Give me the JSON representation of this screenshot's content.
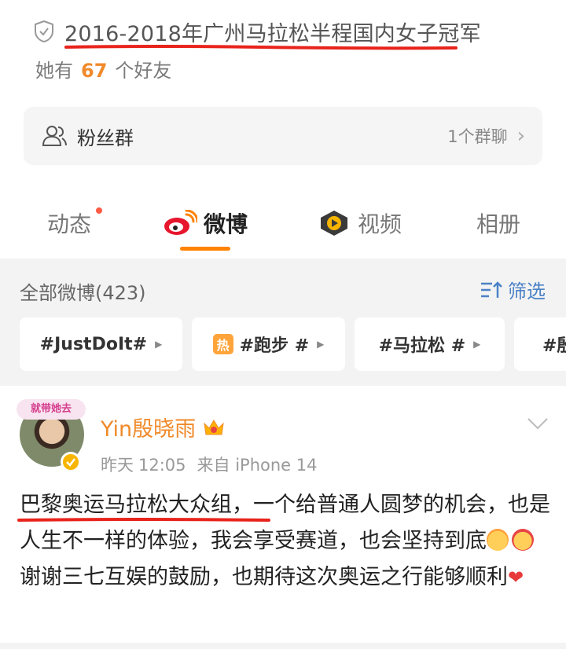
{
  "profile": {
    "honor": "2016-2018年广州马拉松半程国内女子冠军",
    "friends_prefix": "她有",
    "friends_count": "67",
    "friends_suffix": "个好友"
  },
  "fan_group": {
    "label": "粉丝群",
    "count": "1个群聊",
    "chevron": "›"
  },
  "tabs": [
    {
      "label": "动态",
      "has_dot": true
    },
    {
      "label": "微博",
      "active": true
    },
    {
      "label": "视频"
    },
    {
      "label": "相册"
    }
  ],
  "posts_header": {
    "all_label": "全部微博(423)",
    "filter_label": "筛选"
  },
  "topic_chips": [
    {
      "label": "#JustDoIt#"
    },
    {
      "label": "#跑步 #",
      "badge": "热"
    },
    {
      "label": "#马拉松 #"
    },
    {
      "label": "#殷"
    }
  ],
  "post": {
    "avatar_tag": "就带她去",
    "username": "Yin殷晓雨",
    "time_label": "昨天",
    "time": "12:05",
    "source": "来自 iPhone 14",
    "text_part1": "巴黎奥运马拉松大众组，一个给普通人圆梦的机会，也是人生不一样的体验，我会享受赛道，也会坚持到底",
    "text_part2": " 谢谢三七互娱的鼓励，也期待这次奥运之行能够顺利",
    "heart": "❤"
  },
  "colors": {
    "accent": "#ff8200",
    "username": "#f08a2a",
    "link_blue": "#4b82c7",
    "annotation_red": "#e8231b"
  },
  "icons": [
    "shield-icon",
    "people-icon",
    "weibo-icon",
    "video-icon",
    "filter-icon",
    "crown-icon",
    "verified-icon",
    "chevron-down-icon"
  ]
}
